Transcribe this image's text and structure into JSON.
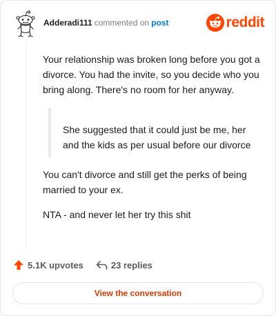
{
  "comment": {
    "username": "Adderadi111",
    "action": "commented on",
    "link_text": "post",
    "paragraph_1": "Your relationship was broken long before you got a divorce. You had the invite, so you decide who you bring along. There's no room for her anyway.",
    "quote": "She suggested that it could just be me, her and the kids as per usual before our divorce",
    "paragraph_2": "You can't divorce and still get the perks of being married to your ex.",
    "paragraph_3": "NTA - and never let her try this shit"
  },
  "brand": {
    "name": "reddit",
    "icon": "reddit-snoo-icon",
    "color": "#ff4500"
  },
  "avatar": {
    "icon": "snoo-avatar-icon"
  },
  "footer": {
    "upvotes_label": "5.1K upvotes",
    "upvote_icon": "upvote-arrow-icon",
    "upvote_color": "#ff4500",
    "replies_label": "23 replies",
    "reply_icon": "reply-arrow-icon"
  },
  "cta": {
    "label": "View the conversation",
    "color": "#d93a00"
  }
}
